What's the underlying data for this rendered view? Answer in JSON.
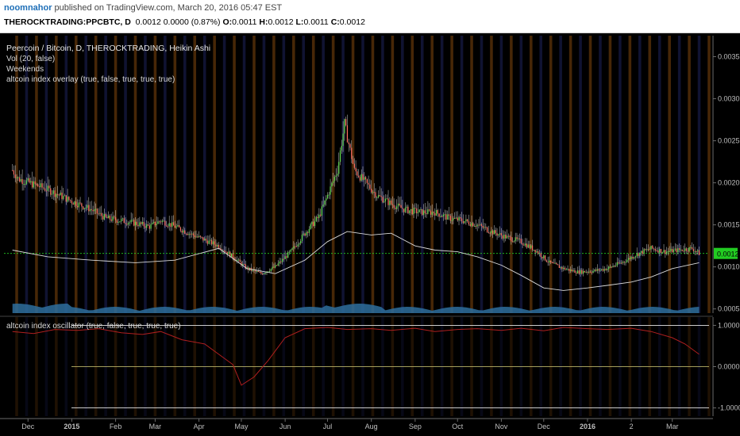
{
  "header": {
    "author": "noomnahor",
    "published": " published on TradingView.com, March 20, 2016 05:47 EST",
    "symbol": "THEROCKTRADING:PPCBTC, D",
    "change": "0.0012 0.0000 (0.87%)",
    "o_label": "O:",
    "o_value": "0.0011",
    "h_label": "H:",
    "h_value": "0.0012",
    "l_label": "L:",
    "l_value": "0.0011",
    "c_label": "C:",
    "c_value": "0.0012"
  },
  "legend": {
    "main": "Peercoin / Bitcoin, D, THEROCKTRADING, Heikin Ashi",
    "vol": "Vol (20, false)",
    "weekends": "Weekends",
    "overlay": "altcoin index overlay (true, false, true, true, true)",
    "oscillator": "altcoin index oscillator (true, false, true, true, true)"
  },
  "colors": {
    "background": "#000000",
    "up_candle": "#66dd55",
    "down_candle": "#ff6f61",
    "wick": "#e6e6e6",
    "overlay_line": "#d9d9d9",
    "price_line": "#22cc22",
    "osc_line": "#b01f1f",
    "osc_upper": "#e8e8e8",
    "osc_mid": "#d8d27a",
    "volume": "#2e6e9e",
    "weekend_a": "#ff8c1a",
    "weekend_b": "#3a44b5"
  },
  "chart_data": [
    {
      "type": "line",
      "title": "Peercoin / Bitcoin, D, THEROCKTRADING, Heikin Ashi",
      "style": "heikin-ashi candles",
      "x_ticks": [
        "Dec",
        "2015",
        "Feb",
        "Mar",
        "Apr",
        "May",
        "Jun",
        "Jul",
        "Aug",
        "Sep",
        "Oct",
        "Nov",
        "Dec",
        "2016",
        "2",
        "Mar"
      ],
      "y_ticks": [
        "0.0035",
        "0.0030",
        "0.0025",
        "0.0020",
        "0.0015",
        "0.0010",
        "0.0005"
      ],
      "ylim": [
        0.00045,
        0.00375
      ],
      "current_price_label": "0.0012",
      "current_price": 0.00116,
      "series": [
        {
          "name": "Peercoin / Bitcoin",
          "x": [
            "2014-11-20",
            "2014-11-24",
            "2014-12-05",
            "2014-12-15",
            "2015-01-01",
            "2015-01-15",
            "2015-01-25",
            "2015-02-05",
            "2015-02-15",
            "2015-02-25",
            "2015-03-05",
            "2015-03-15",
            "2015-03-25",
            "2015-04-05",
            "2015-04-15",
            "2015-04-25",
            "2015-05-05",
            "2015-05-15",
            "2015-05-25",
            "2015-06-05",
            "2015-06-15",
            "2015-06-25",
            "2015-07-01",
            "2015-07-08",
            "2015-07-13",
            "2015-07-20",
            "2015-07-28",
            "2015-08-05",
            "2015-08-15",
            "2015-08-25",
            "2015-09-05",
            "2015-09-15",
            "2015-09-25",
            "2015-10-05",
            "2015-10-15",
            "2015-10-25",
            "2015-11-05",
            "2015-11-15",
            "2015-11-25",
            "2015-12-05",
            "2015-12-15",
            "2015-12-25",
            "2016-01-05",
            "2016-01-15",
            "2016-01-25",
            "2016-02-05",
            "2016-02-15",
            "2016-02-25",
            "2016-03-05",
            "2016-03-15",
            "2016-03-20"
          ],
          "values": [
            0.00215,
            0.00205,
            0.00198,
            0.00192,
            0.00178,
            0.00168,
            0.00158,
            0.00155,
            0.00152,
            0.00148,
            0.00155,
            0.00148,
            0.0014,
            0.00132,
            0.00125,
            0.00112,
            0.00098,
            0.00092,
            0.001,
            0.00118,
            0.0014,
            0.0016,
            0.00185,
            0.00215,
            0.0027,
            0.00215,
            0.002,
            0.00185,
            0.00175,
            0.00168,
            0.00165,
            0.00165,
            0.00158,
            0.00155,
            0.0015,
            0.00142,
            0.00135,
            0.0013,
            0.0012,
            0.00105,
            0.00098,
            0.00094,
            0.00095,
            0.00098,
            0.00105,
            0.00115,
            0.00122,
            0.00118,
            0.0012,
            0.00122,
            0.00116
          ]
        },
        {
          "name": "altcoin index overlay",
          "x": [
            "2014-11-20",
            "2014-12-15",
            "2015-01-15",
            "2015-02-15",
            "2015-03-15",
            "2015-04-15",
            "2015-05-05",
            "2015-05-25",
            "2015-06-15",
            "2015-07-01",
            "2015-07-15",
            "2015-08-01",
            "2015-08-15",
            "2015-09-01",
            "2015-09-15",
            "2015-10-01",
            "2015-10-15",
            "2015-11-01",
            "2015-11-15",
            "2015-12-01",
            "2015-12-15",
            "2016-01-01",
            "2016-01-15",
            "2016-02-01",
            "2016-02-15",
            "2016-03-01",
            "2016-03-20"
          ],
          "values": [
            0.0012,
            0.00112,
            0.00108,
            0.00105,
            0.00108,
            0.00122,
            0.00098,
            0.00092,
            0.00108,
            0.0013,
            0.00142,
            0.00138,
            0.0014,
            0.00125,
            0.0012,
            0.00118,
            0.00112,
            0.00102,
            0.0009,
            0.00075,
            0.00072,
            0.00075,
            0.00078,
            0.00082,
            0.00088,
            0.00098,
            0.00105
          ]
        }
      ]
    },
    {
      "type": "line",
      "title": "altcoin index oscillator (true, false, true, true, true)",
      "y_ticks": [
        "1.0000",
        "0.0000",
        "-1.0000"
      ],
      "ylim": [
        -1.2,
        1.2
      ],
      "levels": [
        1.0,
        0.0,
        -1.0
      ],
      "series": [
        {
          "name": "altcoin index oscillator",
          "x": [
            "2014-11-20",
            "2014-12-05",
            "2014-12-20",
            "2015-01-05",
            "2015-01-20",
            "2015-02-05",
            "2015-02-20",
            "2015-03-05",
            "2015-03-20",
            "2015-04-05",
            "2015-04-15",
            "2015-04-25",
            "2015-05-01",
            "2015-05-10",
            "2015-05-20",
            "2015-06-01",
            "2015-06-15",
            "2015-07-01",
            "2015-07-15",
            "2015-08-01",
            "2015-08-15",
            "2015-09-01",
            "2015-09-15",
            "2015-10-01",
            "2015-10-15",
            "2015-11-01",
            "2015-11-15",
            "2015-12-01",
            "2015-12-15",
            "2016-01-01",
            "2016-01-15",
            "2016-02-01",
            "2016-02-15",
            "2016-03-01",
            "2016-03-10",
            "2016-03-20"
          ],
          "values": [
            0.85,
            0.8,
            0.9,
            0.88,
            0.92,
            0.82,
            0.78,
            0.85,
            0.65,
            0.55,
            0.3,
            0.05,
            -0.45,
            -0.25,
            0.15,
            0.7,
            0.92,
            0.95,
            0.9,
            0.92,
            0.88,
            0.93,
            0.85,
            0.9,
            0.92,
            0.88,
            0.93,
            0.87,
            0.95,
            0.92,
            0.9,
            0.93,
            0.85,
            0.7,
            0.55,
            0.3
          ]
        }
      ]
    }
  ]
}
